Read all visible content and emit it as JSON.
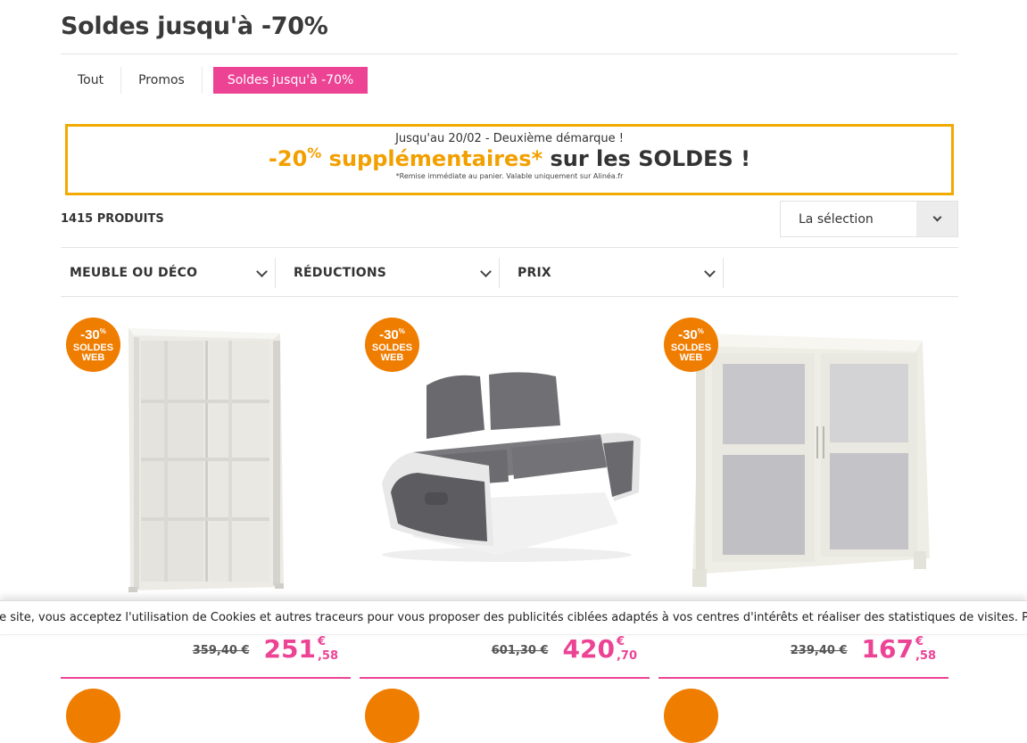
{
  "page": {
    "title": "Soldes jusqu'à -70%"
  },
  "tabs": [
    {
      "label": "Tout"
    },
    {
      "label": "Promos"
    },
    {
      "label": "Soldes jusqu'à -70%"
    }
  ],
  "promo": {
    "top": "Jusqu'au 20/02 - Deuxième démarque !",
    "amount": "-20",
    "percent": "%",
    "highlight": " supplémentaires*",
    "rest": " sur les SOLDES !",
    "note": "*Remise immédiate au panier. Valable uniquement sur Alinéa.fr"
  },
  "listing": {
    "count": "1415 PRODUITS",
    "sort_value": "La sélection"
  },
  "filters": [
    {
      "label": "MEUBLE OU DÉCO"
    },
    {
      "label": "RÉDUCTIONS"
    },
    {
      "label": "PRIX"
    }
  ],
  "badge": {
    "discount": "-30",
    "percent": "%",
    "line1": "SOLDES",
    "line2": "WEB"
  },
  "products": [
    {
      "old_price": "359,40 €",
      "price_int": "251",
      "currency": "€",
      "price_dec": ",58"
    },
    {
      "old_price": "601,30 €",
      "price_int": "420",
      "currency": "€",
      "price_dec": ",70"
    },
    {
      "old_price": "239,40 €",
      "price_int": "167",
      "currency": "€",
      "price_dec": ",58"
    }
  ],
  "cookie": {
    "text": "ce site, vous acceptez l'utilisation de Cookies et autres traceurs pour vous proposer des publicités ciblées adaptés à vos centres d'intérêts et réaliser des statistiques de visites. Pour en savoir plus et"
  },
  "colors": {
    "accent_pink": "#ec4395",
    "badge_orange": "#ef7d00",
    "banner_border": "#f2a900"
  }
}
